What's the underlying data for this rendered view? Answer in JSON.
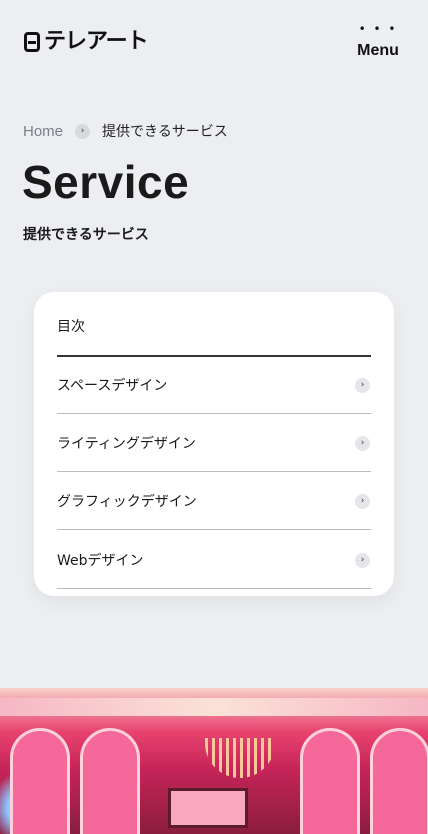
{
  "header": {
    "logo_text": "テレアート",
    "menu_dots": "• • •",
    "menu_label": "Menu"
  },
  "breadcrumb": {
    "home": "Home",
    "separator": "›",
    "current": "提供できるサービス"
  },
  "page": {
    "title": "Service",
    "subtitle": "提供できるサービス"
  },
  "toc": {
    "heading": "目次",
    "items": [
      {
        "label": "スペースデザイン",
        "arrow": "›"
      },
      {
        "label": "ライティングデザイン",
        "arrow": "›"
      },
      {
        "label": "グラフィックデザイン",
        "arrow": "›"
      },
      {
        "label": "Webデザイン",
        "arrow": "›"
      }
    ]
  },
  "colors": {
    "background": "#eceef1",
    "card": "#ffffff",
    "text": "#1a1a1a",
    "muted": "#7a7f87"
  }
}
